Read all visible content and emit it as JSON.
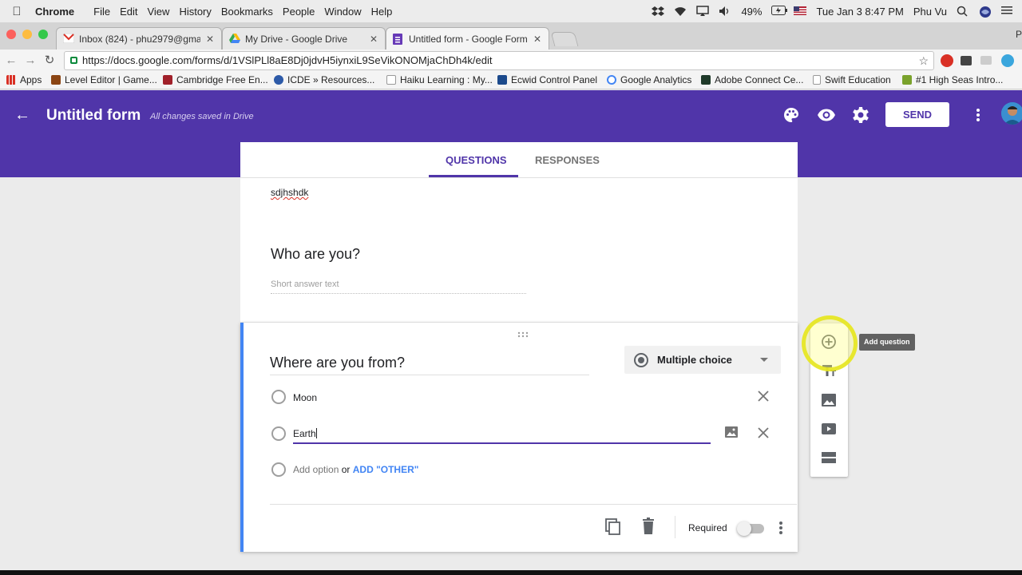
{
  "menubar": {
    "app": "Chrome",
    "items": [
      "File",
      "Edit",
      "View",
      "History",
      "Bookmarks",
      "People",
      "Window",
      "Help"
    ],
    "battery": "49%",
    "datetime": "Tue Jan 3  8:47 PM",
    "user": "Phu Vu"
  },
  "tabs": [
    {
      "title": "Inbox (824) - phu2979@gmail",
      "icon": "gmail-icon"
    },
    {
      "title": "My Drive - Google Drive",
      "icon": "drive-icon"
    },
    {
      "title": "Untitled form - Google Forms",
      "icon": "forms-icon",
      "active": true
    }
  ],
  "profile_initial": "P",
  "url": "https://docs.google.com/forms/d/1VSlPLl8aE8Dj0jdvH5iynxiL9SeVikONOMjaChDh4k/edit",
  "bookmarks": [
    "Apps",
    "Level Editor | Game...",
    "Cambridge Free En...",
    "ICDE » Resources...",
    "Haiku Learning : My...",
    "Ecwid Control Panel",
    "Google Analytics",
    "Adobe Connect Ce...",
    "Swift Education",
    "#1 High Seas Intro..."
  ],
  "form_header": {
    "title": "Untitled form",
    "save_status": "All changes saved in Drive",
    "send_label": "SEND"
  },
  "form_tabs": {
    "questions": "QUESTIONS",
    "responses": "RESPONSES"
  },
  "previous_text": "sdjhshdk",
  "question1": {
    "title": "Who are you?",
    "placeholder": "Short answer text"
  },
  "question2": {
    "title": "Where are you from?",
    "type": "Multiple choice",
    "options": [
      "Moon",
      "Earth"
    ],
    "add_option": "Add option",
    "or": "or",
    "add_other": "ADD \"OTHER\"",
    "required_label": "Required",
    "required": false
  },
  "side_toolbar": {
    "tooltip": "Add question"
  },
  "colors": {
    "accent": "#5035a9",
    "focus_border": "#4285f4",
    "link_blue": "#4285f4"
  }
}
